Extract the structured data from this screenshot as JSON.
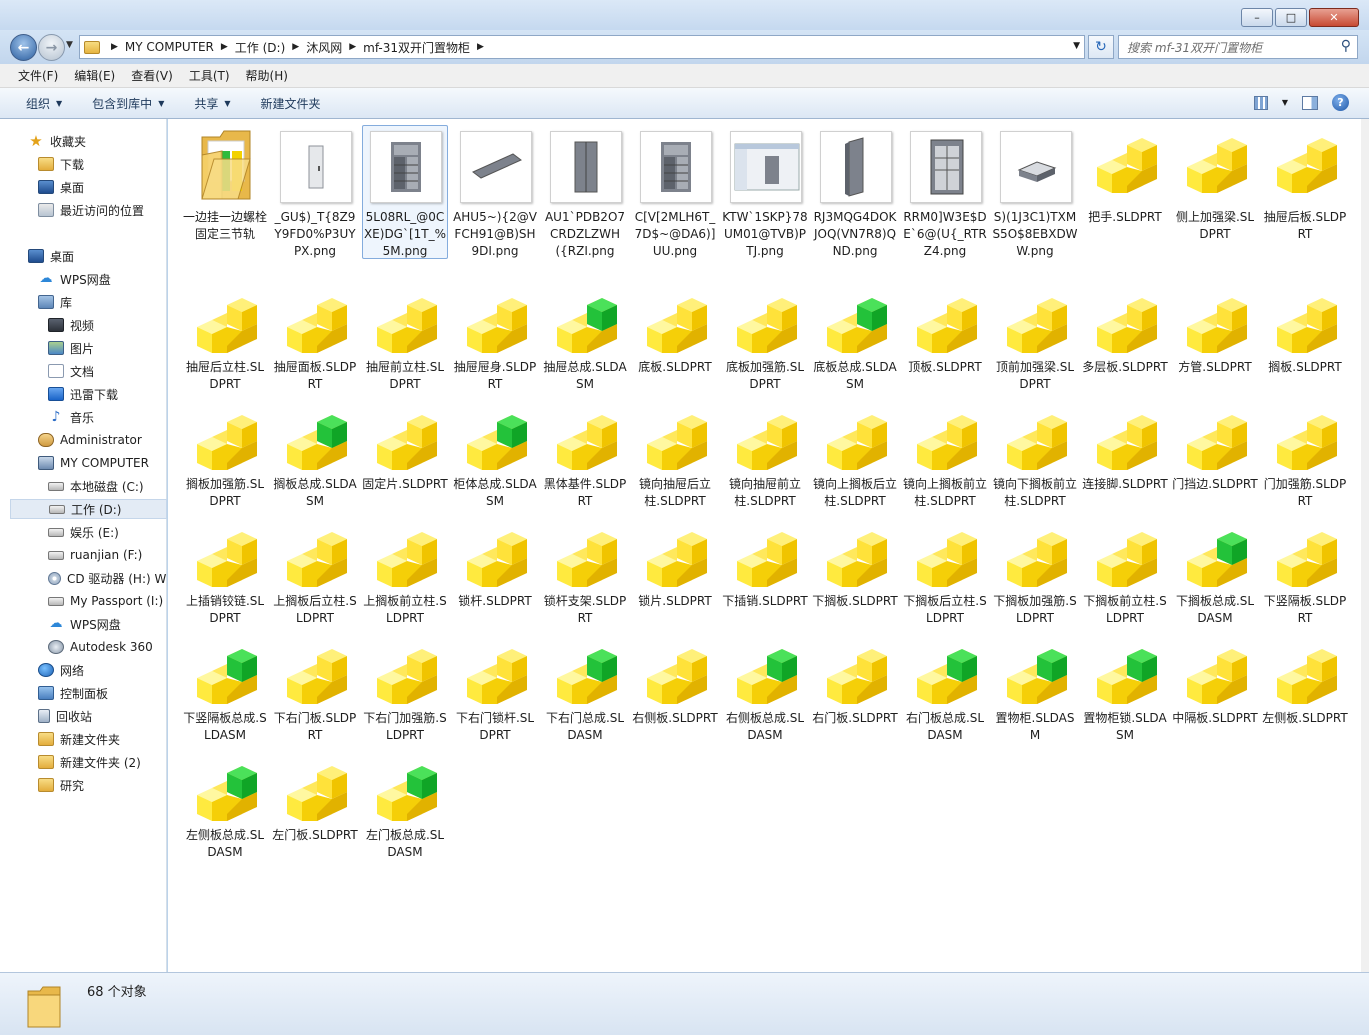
{
  "window": {
    "minimize_label": "–",
    "maximize_label": "□",
    "close_label": "✕"
  },
  "address": {
    "crumbs": [
      "MY COMPUTER",
      "工作 (D:)",
      "沐风网",
      "mf-31双开门置物柜"
    ],
    "search_placeholder": "搜索 mf-31双开门置物柜"
  },
  "menu": [
    "文件(F)",
    "编辑(E)",
    "查看(V)",
    "工具(T)",
    "帮助(H)"
  ],
  "toolbar": {
    "organize": "组织",
    "include_library": "包含到库中",
    "share": "共享",
    "new_folder": "新建文件夹"
  },
  "nav": [
    {
      "label": "收藏夹",
      "icon": "star-icon"
    },
    {
      "label": "下载",
      "icon": "folder-icon"
    },
    {
      "label": "桌面",
      "icon": "desktop-icon"
    },
    {
      "label": "最近访问的位置",
      "icon": "recent-places-icon"
    },
    {
      "label": "桌面",
      "icon": "desktop-icon"
    },
    {
      "label": "WPS网盘",
      "icon": "cloud-icon"
    },
    {
      "label": "库",
      "icon": "library-icon"
    },
    {
      "label": "视频",
      "icon": "video-icon"
    },
    {
      "label": "图片",
      "icon": "picture-icon"
    },
    {
      "label": "文档",
      "icon": "document-icon"
    },
    {
      "label": "迅雷下载",
      "icon": "thunder-icon"
    },
    {
      "label": "音乐",
      "icon": "music-icon"
    },
    {
      "label": "Administrator",
      "icon": "user-folder-icon"
    },
    {
      "label": "MY COMPUTER",
      "icon": "computer-icon"
    },
    {
      "label": "本地磁盘 (C:)",
      "icon": "drive-icon"
    },
    {
      "label": "工作 (D:)",
      "icon": "drive-icon"
    },
    {
      "label": "娱乐 (E:)",
      "icon": "drive-icon"
    },
    {
      "label": "ruanjian (F:)",
      "icon": "drive-icon"
    },
    {
      "label": "CD 驱动器 (H:) W",
      "icon": "cd-drive-icon"
    },
    {
      "label": "My Passport (I:)",
      "icon": "drive-icon"
    },
    {
      "label": "WPS网盘",
      "icon": "cloud-icon"
    },
    {
      "label": "Autodesk 360",
      "icon": "autodesk-icon"
    },
    {
      "label": "网络",
      "icon": "network-icon"
    },
    {
      "label": "控制面板",
      "icon": "control-panel-icon"
    },
    {
      "label": "回收站",
      "icon": "recycle-bin-icon"
    },
    {
      "label": "新建文件夹",
      "icon": "folder-icon"
    },
    {
      "label": "新建文件夹 (2)",
      "icon": "folder-icon"
    },
    {
      "label": "研究",
      "icon": "folder-icon"
    }
  ],
  "files": [
    {
      "name": "一边挂一边螺栓固定三节轨",
      "kind": "folder"
    },
    {
      "name": "_GU$)_T{8Z9Y9FD0%P3UYPX.png",
      "kind": "png",
      "thumb": "door"
    },
    {
      "name": "5L08RL_@0CXE)DG`[1T_%5M.png",
      "kind": "png",
      "thumb": "cabinet-open"
    },
    {
      "name": "AHU5~){2@VFCH91@B)SH9DI.png",
      "kind": "png",
      "thumb": "plate"
    },
    {
      "name": "AU1`PDB2O7CRDZLZWH({RZI.png",
      "kind": "png",
      "thumb": "cabinet"
    },
    {
      "name": "C[V[2MLH6T_7D$~@DA6)]UU.png",
      "kind": "png",
      "thumb": "cabinet-open"
    },
    {
      "name": "KTW`1SKP}78UM01@TVB)PTJ.png",
      "kind": "png",
      "thumb": "screenshot"
    },
    {
      "name": "RJ3MQG4DOKJOQ(VN7R8)QND.png",
      "kind": "png",
      "thumb": "panel"
    },
    {
      "name": "RRM0]W3E$DE`6@(U{_RTRZ4.png",
      "kind": "png",
      "thumb": "cabinet-frame"
    },
    {
      "name": "S)(1J3C1)TXMS5O$8EBXDWW.png",
      "kind": "png",
      "thumb": "drawer"
    },
    {
      "name": "把手.SLDPRT",
      "kind": "part"
    },
    {
      "name": "侧上加强梁.SLDPRT",
      "kind": "part"
    },
    {
      "name": "抽屉后板.SLDPRT",
      "kind": "part"
    },
    {
      "name": "抽屉后立柱.SLDPRT",
      "kind": "part"
    },
    {
      "name": "抽屉面板.SLDPRT",
      "kind": "part"
    },
    {
      "name": "抽屉前立柱.SLDPRT",
      "kind": "part"
    },
    {
      "name": "抽屉屉身.SLDPRT",
      "kind": "part"
    },
    {
      "name": "抽屉总成.SLDASM",
      "kind": "asm"
    },
    {
      "name": "底板.SLDPRT",
      "kind": "part"
    },
    {
      "name": "底板加强筋.SLDPRT",
      "kind": "part"
    },
    {
      "name": "底板总成.SLDASM",
      "kind": "asm"
    },
    {
      "name": "顶板.SLDPRT",
      "kind": "part"
    },
    {
      "name": "顶前加强梁.SLDPRT",
      "kind": "part"
    },
    {
      "name": "多层板.SLDPRT",
      "kind": "part"
    },
    {
      "name": "方管.SLDPRT",
      "kind": "part"
    },
    {
      "name": "搁板.SLDPRT",
      "kind": "part"
    },
    {
      "name": "搁板加强筋.SLDPRT",
      "kind": "part"
    },
    {
      "name": "搁板总成.SLDASM",
      "kind": "asm"
    },
    {
      "name": "固定片.SLDPRT",
      "kind": "part"
    },
    {
      "name": "柜体总成.SLDASM",
      "kind": "asm"
    },
    {
      "name": "黑体基件.SLDPRT",
      "kind": "part"
    },
    {
      "name": "镜向抽屉后立柱.SLDPRT",
      "kind": "part"
    },
    {
      "name": "镜向抽屉前立柱.SLDPRT",
      "kind": "part"
    },
    {
      "name": "镜向上搁板后立柱.SLDPRT",
      "kind": "part"
    },
    {
      "name": "镜向上搁板前立柱.SLDPRT",
      "kind": "part"
    },
    {
      "name": "镜向下搁板前立柱.SLDPRT",
      "kind": "part"
    },
    {
      "name": "连接脚.SLDPRT",
      "kind": "part"
    },
    {
      "name": "门挡边.SLDPRT",
      "kind": "part"
    },
    {
      "name": "门加强筋.SLDPRT",
      "kind": "part"
    },
    {
      "name": "上插销铰链.SLDPRT",
      "kind": "part"
    },
    {
      "name": "上搁板后立柱.SLDPRT",
      "kind": "part"
    },
    {
      "name": "上搁板前立柱.SLDPRT",
      "kind": "part"
    },
    {
      "name": "锁杆.SLDPRT",
      "kind": "part"
    },
    {
      "name": "锁杆支架.SLDPRT",
      "kind": "part"
    },
    {
      "name": "锁片.SLDPRT",
      "kind": "part"
    },
    {
      "name": "下插销.SLDPRT",
      "kind": "part"
    },
    {
      "name": "下搁板.SLDPRT",
      "kind": "part"
    },
    {
      "name": "下搁板后立柱.SLDPRT",
      "kind": "part"
    },
    {
      "name": "下搁板加强筋.SLDPRT",
      "kind": "part"
    },
    {
      "name": "下搁板前立柱.SLDPRT",
      "kind": "part"
    },
    {
      "name": "下搁板总成.SLDASM",
      "kind": "asm"
    },
    {
      "name": "下竖隔板.SLDPRT",
      "kind": "part"
    },
    {
      "name": "下竖隔板总成.SLDASM",
      "kind": "asm"
    },
    {
      "name": "下右门板.SLDPRT",
      "kind": "part"
    },
    {
      "name": "下右门加强筋.SLDPRT",
      "kind": "part"
    },
    {
      "name": "下右门锁杆.SLDPRT",
      "kind": "part"
    },
    {
      "name": "下右门总成.SLDASM",
      "kind": "asm"
    },
    {
      "name": "右侧板.SLDPRT",
      "kind": "part"
    },
    {
      "name": "右侧板总成.SLDASM",
      "kind": "asm"
    },
    {
      "name": "右门板.SLDPRT",
      "kind": "part"
    },
    {
      "name": "右门板总成.SLDASM",
      "kind": "asm"
    },
    {
      "name": "置物柜.SLDASM",
      "kind": "asm"
    },
    {
      "name": "置物柜锁.SLDASM",
      "kind": "asm"
    },
    {
      "name": "中隔板.SLDPRT",
      "kind": "part"
    },
    {
      "name": "左侧板.SLDPRT",
      "kind": "part"
    },
    {
      "name": "左侧板总成.SLDASM",
      "kind": "asm"
    },
    {
      "name": "左门板.SLDPRT",
      "kind": "part"
    },
    {
      "name": "左门板总成.SLDASM",
      "kind": "asm"
    }
  ],
  "status": {
    "count_text": "68 个对象"
  }
}
